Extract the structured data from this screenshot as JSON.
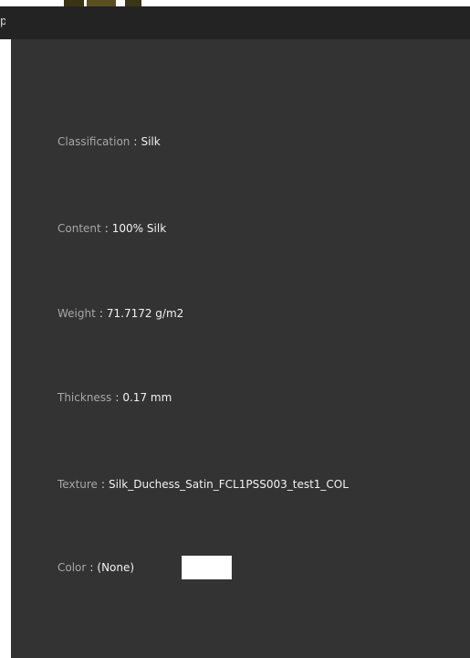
{
  "header": {
    "title_fragment": "p"
  },
  "properties": [
    {
      "label": "Classification",
      "separator": ":",
      "value": "Silk"
    },
    {
      "label": "Content",
      "separator": ":",
      "value": "100% Silk"
    },
    {
      "label": "Weight",
      "separator": ":",
      "value": "71.7172 g/m2"
    },
    {
      "label": "Thickness",
      "separator": ":",
      "value": "0.17 mm"
    },
    {
      "label": "Texture",
      "separator": ":",
      "value": "Silk_Duchess_Satin_FCL1PSS003_test1_COL"
    },
    {
      "label": "Color",
      "separator": ":",
      "value": "(None)"
    }
  ],
  "colors": {
    "panel_background": "#333333",
    "header_background": "#232323",
    "label_color": "#a7a7a7",
    "value_color": "#f2f2f2",
    "swatch_color": "#ffffff"
  }
}
